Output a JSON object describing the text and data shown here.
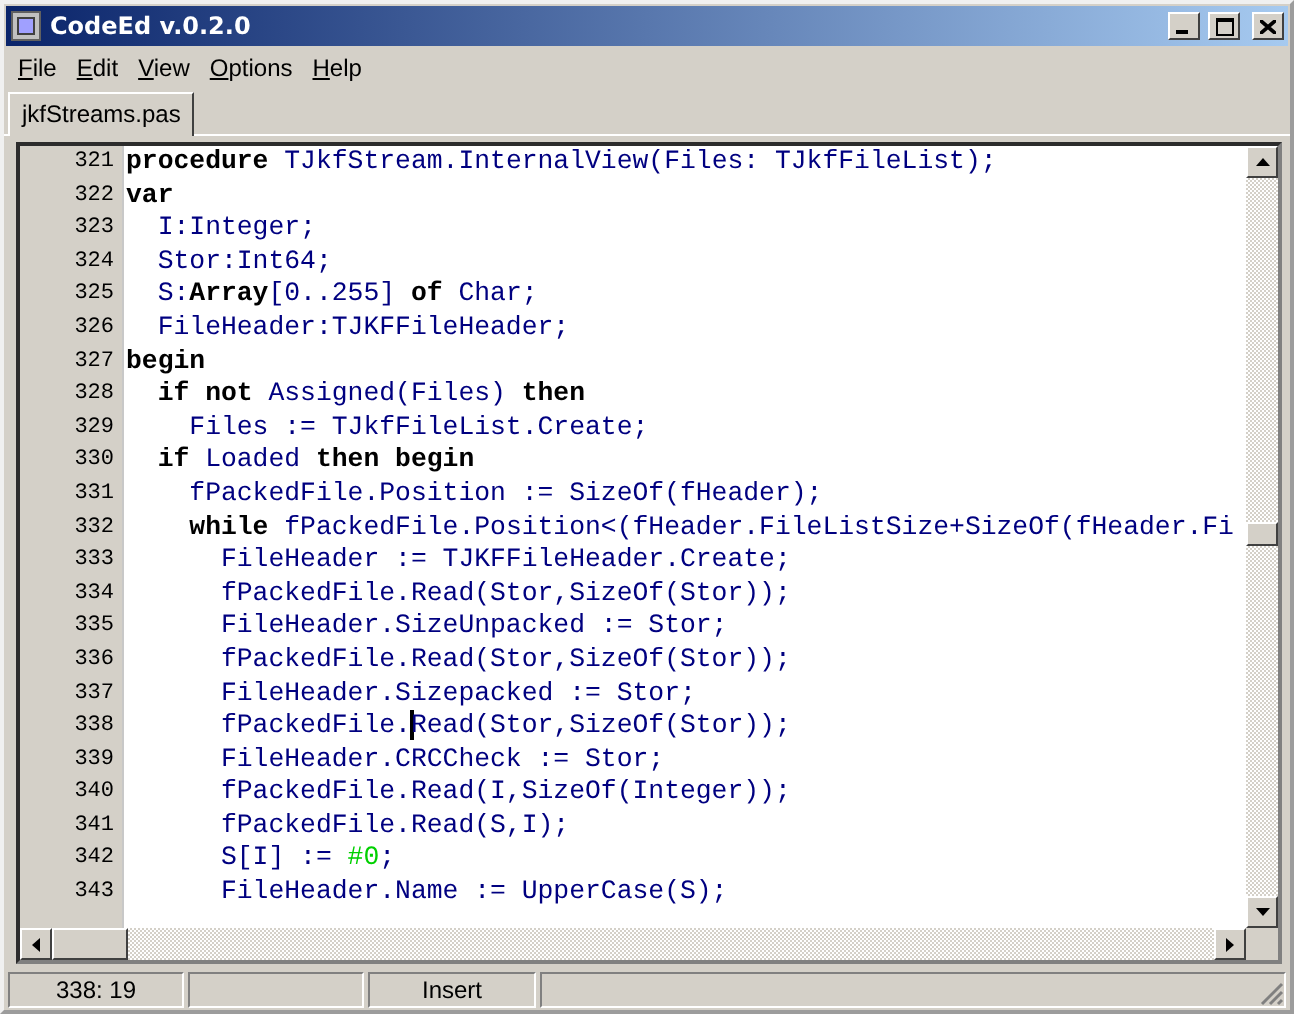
{
  "window": {
    "title": "CodeEd v.0.2.0"
  },
  "menu": [
    {
      "label": "File"
    },
    {
      "label": "Edit"
    },
    {
      "label": "View"
    },
    {
      "label": "Options"
    },
    {
      "label": "Help"
    }
  ],
  "tabs": [
    {
      "label": "jkfStreams.pas",
      "selected": true
    }
  ],
  "editor": {
    "lines": [
      {
        "number": "321",
        "tokens": [
          {
            "text": "procedure",
            "kind": "keyword"
          },
          {
            "text": " TJkfStream.InternalView(Files: TJkfFileList);",
            "kind": "ident"
          }
        ]
      },
      {
        "number": "322",
        "tokens": [
          {
            "text": "var",
            "kind": "keyword"
          }
        ]
      },
      {
        "number": "323",
        "tokens": [
          {
            "text": "  I:Integer;",
            "kind": "ident"
          }
        ]
      },
      {
        "number": "324",
        "tokens": [
          {
            "text": "  Stor:Int64;",
            "kind": "ident"
          }
        ]
      },
      {
        "number": "325",
        "tokens": [
          {
            "text": "  S:",
            "kind": "ident"
          },
          {
            "text": "Array",
            "kind": "keyword"
          },
          {
            "text": "[0..255] ",
            "kind": "ident"
          },
          {
            "text": "of",
            "kind": "keyword"
          },
          {
            "text": " Char;",
            "kind": "ident"
          }
        ]
      },
      {
        "number": "326",
        "tokens": [
          {
            "text": "  FileHeader:TJKFFileHeader;",
            "kind": "ident"
          }
        ]
      },
      {
        "number": "327",
        "tokens": [
          {
            "text": "begin",
            "kind": "keyword"
          }
        ]
      },
      {
        "number": "328",
        "tokens": [
          {
            "text": "  if not",
            "kind": "keyword"
          },
          {
            "text": " Assigned(Files) ",
            "kind": "ident"
          },
          {
            "text": "then",
            "kind": "keyword"
          }
        ]
      },
      {
        "number": "329",
        "tokens": [
          {
            "text": "    Files := TJkfFileList.Create;",
            "kind": "ident"
          }
        ]
      },
      {
        "number": "330",
        "tokens": [
          {
            "text": "  if",
            "kind": "keyword"
          },
          {
            "text": " Loaded ",
            "kind": "ident"
          },
          {
            "text": "then begin",
            "kind": "keyword"
          }
        ]
      },
      {
        "number": "331",
        "tokens": [
          {
            "text": "    fPackedFile.Position := SizeOf(fHeader);",
            "kind": "ident"
          }
        ]
      },
      {
        "number": "332",
        "tokens": [
          {
            "text": "    while",
            "kind": "keyword"
          },
          {
            "text": " fPackedFile.Position<(fHeader.FileListSize+SizeOf(fHeader.Fi",
            "kind": "ident"
          }
        ]
      },
      {
        "number": "333",
        "tokens": [
          {
            "text": "      FileHeader := TJKFFileHeader.Create;",
            "kind": "ident"
          }
        ]
      },
      {
        "number": "334",
        "tokens": [
          {
            "text": "      fPackedFile.Read(Stor,SizeOf(Stor));",
            "kind": "ident"
          }
        ]
      },
      {
        "number": "335",
        "tokens": [
          {
            "text": "      FileHeader.SizeUnpacked := Stor;",
            "kind": "ident"
          }
        ]
      },
      {
        "number": "336",
        "tokens": [
          {
            "text": "      fPackedFile.Read(Stor,SizeOf(Stor));",
            "kind": "ident"
          }
        ]
      },
      {
        "number": "337",
        "tokens": [
          {
            "text": "      FileHeader.Sizepacked := Stor;",
            "kind": "ident"
          }
        ]
      },
      {
        "number": "338",
        "tokens": [
          {
            "text": "      fPackedFile.",
            "kind": "ident"
          },
          {
            "text": "Read(Stor,SizeOf(Stor));",
            "kind": "ident",
            "caret": true
          }
        ]
      },
      {
        "number": "339",
        "tokens": [
          {
            "text": "      FileHeader.CRCCheck := Stor;",
            "kind": "ident"
          }
        ]
      },
      {
        "number": "340",
        "tokens": [
          {
            "text": "      fPackedFile.Read(I,SizeOf(Integer));",
            "kind": "ident"
          }
        ]
      },
      {
        "number": "341",
        "tokens": [
          {
            "text": "      fPackedFile.Read(S,I);",
            "kind": "ident"
          }
        ]
      },
      {
        "number": "342",
        "tokens": [
          {
            "text": "      S[I] := ",
            "kind": "ident"
          },
          {
            "text": "#0",
            "kind": "string"
          },
          {
            "text": ";",
            "kind": "ident"
          }
        ]
      },
      {
        "number": "343",
        "tokens": [
          {
            "text": "      FileHeader.Name := UpperCase(S);",
            "kind": "ident"
          }
        ]
      }
    ]
  },
  "status_bar": [
    {
      "text": "338: 19"
    },
    {
      "text": "Insert"
    }
  ]
}
